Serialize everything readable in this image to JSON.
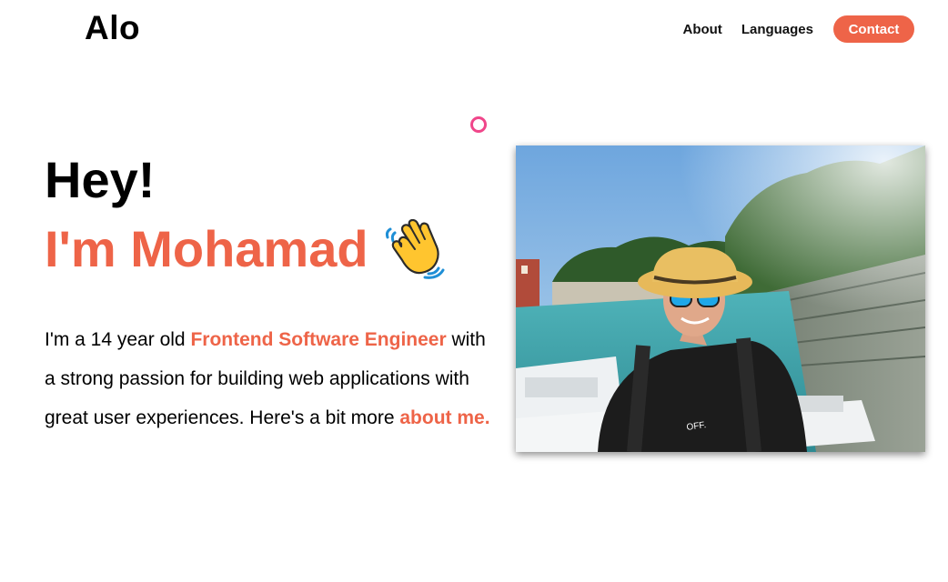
{
  "header": {
    "logo_text": "Alo",
    "nav": [
      {
        "label": "About"
      },
      {
        "label": "Languages"
      }
    ],
    "contact_label": "Contact"
  },
  "hero": {
    "greeting": "Hey!",
    "name_line": "I'm Mohamad",
    "wave_icon": "waving-hand-emoji",
    "bio_prefix": "I'm a 14 year old ",
    "bio_role": "Frontend Software Engineer",
    "bio_middle": " with a strong passion for building web applications with great user experiences. Here's a bit more ",
    "bio_link": "about me."
  },
  "colors": {
    "accent": "#ee6448",
    "ring": "#f0468a"
  }
}
